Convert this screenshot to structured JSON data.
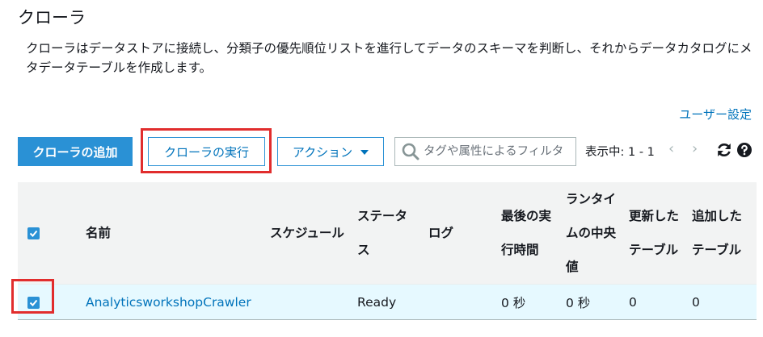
{
  "page": {
    "title": "クローラ",
    "description": "クローラはデータストアに接続し、分類子の優先順位リストを進行してデータのスキーマを判断し、それからデータカタログにメタデータテーブルを作成します。",
    "user_settings": "ユーザー設定"
  },
  "toolbar": {
    "add_label": "クローラの追加",
    "run_label": "クローラの実行",
    "action_label": "アクション",
    "search_placeholder": "タグや属性によるフィルタ",
    "pager_text": "表示中: 1 - 1",
    "prev_glyph": "‹",
    "next_glyph": "›"
  },
  "icons": [
    "search-icon",
    "refresh-icon",
    "help-icon",
    "chevron-left-icon",
    "chevron-right-icon",
    "caret-down-icon",
    "checkbox-checked-icon"
  ],
  "colors": {
    "primary": "#2a91d5",
    "link": "#0073bb",
    "highlight": "#e12d2d",
    "selected_row": "#e6f9ff",
    "header_bg": "#f2f3f3"
  },
  "table": {
    "columns": [
      "名前",
      "スケジュール",
      "ステータス",
      "ログ",
      "最後の実行時間",
      "ランタイムの中央値",
      "更新したテーブル",
      "追加したテーブル"
    ],
    "rows": [
      {
        "selected": true,
        "name": "AnalyticsworkshopCrawler",
        "schedule": "",
        "status": "Ready",
        "log": "",
        "last_runtime": "0 秒",
        "median_runtime": "0 秒",
        "tables_updated": "0",
        "tables_added": "0"
      }
    ]
  }
}
